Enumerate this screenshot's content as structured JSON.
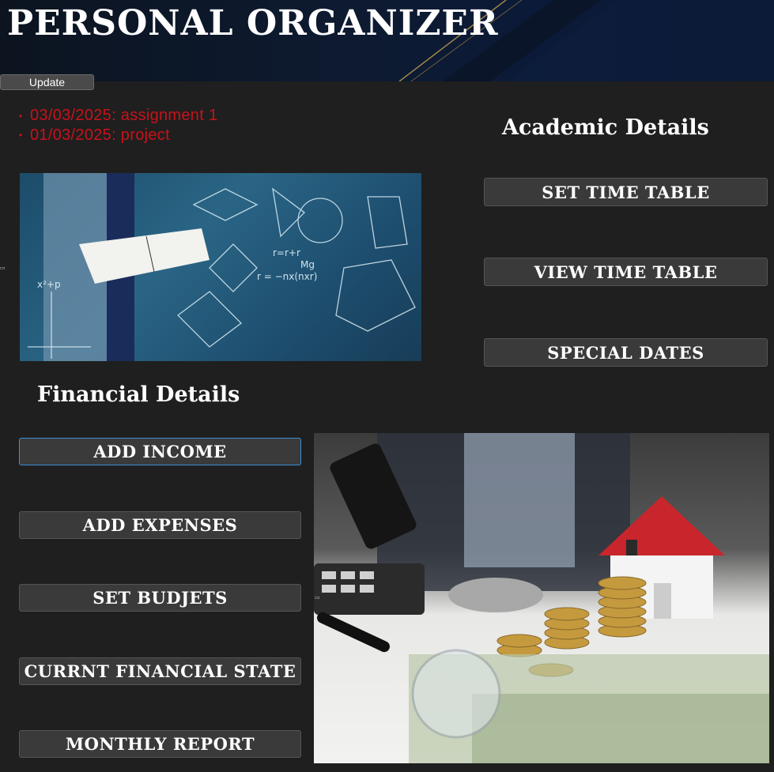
{
  "header": {
    "title": "PERSONAL ORGANIZER"
  },
  "toolbar": {
    "update_label": "Update"
  },
  "reminders": [
    {
      "text": "03/03/2025: assignment 1"
    },
    {
      "text": "01/03/2025: project"
    }
  ],
  "academic": {
    "title": "Academic Details",
    "buttons": {
      "set_time_table": "SET TIME TABLE",
      "view_time_table": "VIEW TIME TABLE",
      "special_dates": "SPECIAL DATES"
    }
  },
  "financial": {
    "title": "Financial Details",
    "buttons": {
      "add_income": "ADD INCOME",
      "add_expenses": "ADD EXPENSES",
      "set_budjets": "SET BUDJETS",
      "current_state": "CURRNT FINANCIAL STATE",
      "monthly_report": "MONTHLY REPORT"
    }
  },
  "colors": {
    "reminder_text": "#c8121a",
    "background": "#1f1f1f",
    "button_bg": "#3a3a3a",
    "focus_border": "#3a8fd8"
  }
}
